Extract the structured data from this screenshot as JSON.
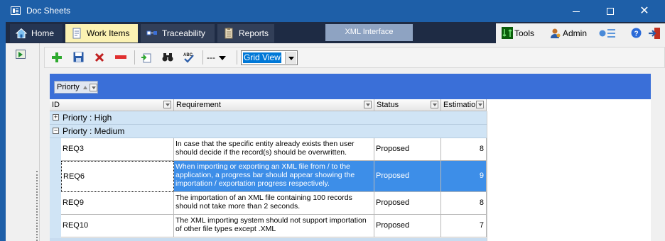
{
  "window": {
    "title": "Doc Sheets",
    "min_label": "",
    "max_label": "",
    "close_label": "✕"
  },
  "nav": {
    "tabs": [
      {
        "label": "Home",
        "icon": "home-icon"
      },
      {
        "label": "Work Items",
        "icon": "document-icon"
      },
      {
        "label": "Traceability",
        "icon": "traceability-icon"
      },
      {
        "label": "Reports",
        "icon": "report-icon"
      }
    ],
    "center_tab": "XML Interface",
    "tools_label": "Tools",
    "admin_label": "Admin"
  },
  "toolbar": {
    "add_icon": "add-icon",
    "save_icon": "save-icon",
    "delete_icon": "delete-icon",
    "remove_icon": "remove-icon",
    "dash_label": "---",
    "view_select_value": "Grid View"
  },
  "grid": {
    "group_by_label": "Priorty",
    "columns": [
      "ID",
      "Requirement",
      "Status",
      "Estimation"
    ],
    "groups": [
      {
        "label": "Priorty : High",
        "expanded": false,
        "toggle": "+"
      },
      {
        "label": "Priorty : Medium",
        "expanded": true,
        "toggle": "−"
      }
    ],
    "rows": [
      {
        "id": "REQ3",
        "requirement": "In case that the specific entity already exists then user should decide if the record(s) should be overwritten.",
        "status": "Proposed",
        "estimation": "8"
      },
      {
        "id": "REQ6",
        "requirement": "When importing or exporting an XML file from / to the application, a progress bar should appear showing the importation / exportation progress respectively.",
        "status": "Proposed",
        "estimation": "9"
      },
      {
        "id": "REQ9",
        "requirement": "The importation of an XML file containing 100 records should not take more than 2 seconds.",
        "status": "Proposed",
        "estimation": "8"
      },
      {
        "id": "REQ10",
        "requirement": "The XML importing system should not support importation of other file types except .XML",
        "status": "Proposed",
        "estimation": "7"
      }
    ],
    "selected_row": 1
  },
  "colors": {
    "titlebar": "#1e5fa8",
    "navbar": "#1e2b44",
    "work_tab": "#fbf2b3",
    "group_panel": "#3a6fd8",
    "selection": "#3d8ee8"
  }
}
